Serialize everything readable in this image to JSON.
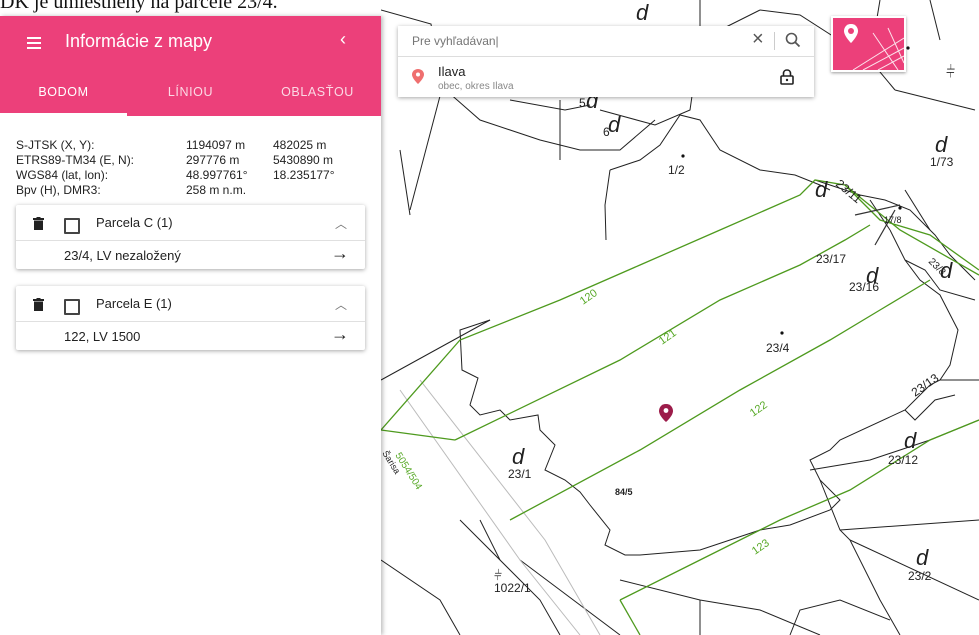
{
  "top_text": "DK je umiestnený na parcele 23/4.",
  "panel": {
    "title": "Informácie z mapy",
    "tabs": [
      "BODOM",
      "LÍNIOU",
      "OBLASŤOU"
    ],
    "coords": [
      {
        "label": "S-JTSK (X, Y):",
        "v1": "1194097 m",
        "v2": "482025 m"
      },
      {
        "label": "ETRS89-TM34 (E, N):",
        "v1": "297776 m",
        "v2": "5430890 m"
      },
      {
        "label": "WGS84 (lat, lon):",
        "v1": "48.997761°",
        "v2": "18.235177°"
      },
      {
        "label": "Bpv (H), DMR3:",
        "v1": "258 m n.m.",
        "v2": ""
      }
    ],
    "cards": [
      {
        "title": "Parcela C (1)",
        "item": "23/4, LV nezaložený"
      },
      {
        "title": "Parcela E (1)",
        "item": "122, LV 1500"
      }
    ]
  },
  "search": {
    "placeholder": "Pre vyhľadávan|",
    "result_title": "Ilava",
    "result_subtitle": "obec, okres Ilava"
  },
  "map_labels": {
    "l_5": "5",
    "l_6": "6",
    "l_1_2": "1/2",
    "l_17_3": "1/73",
    "l_23_11": "23/11",
    "l_17_8": "17/8",
    "l_23_17": "23/17",
    "l_23_16": "23/16",
    "l_23_8": "23/8",
    "l_23_4": "23/4",
    "l_23_13": "23/13",
    "l_23_12": "23/12",
    "l_23_1": "23/1",
    "l_23_2": "23/2",
    "l_1022_1": "1022/1",
    "l_84_5": "84/5",
    "l_120": "120",
    "l_121": "121",
    "l_122": "122",
    "l_123": "123",
    "l_5054": "5054/504",
    "l_sarisa": "Šarisa",
    "d": "d"
  },
  "colors": {
    "accent": "#ec407a",
    "parcel_e": "#4e9a1e",
    "pin": "#9c1c4a",
    "parcel_line": "#222222"
  }
}
